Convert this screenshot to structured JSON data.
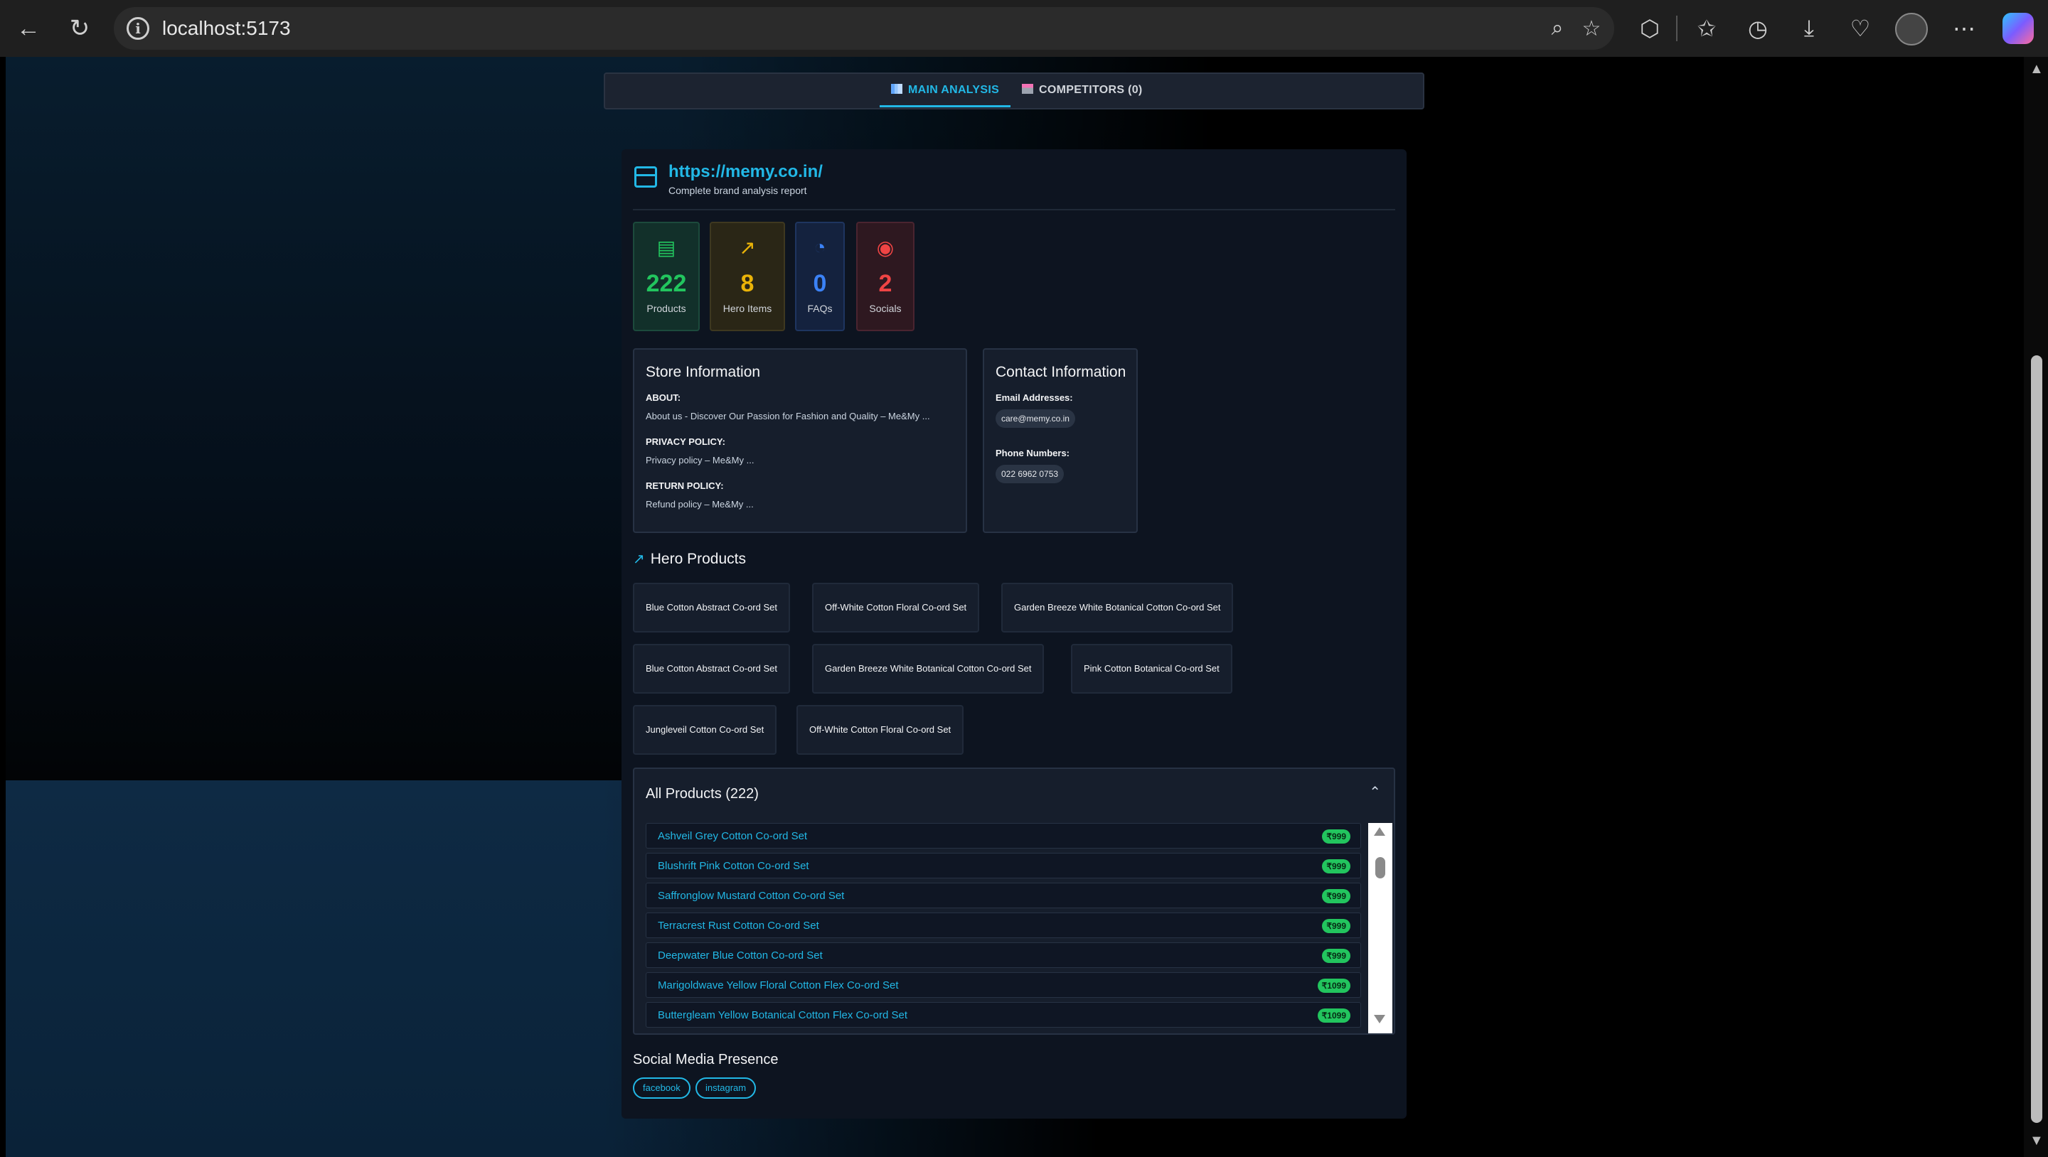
{
  "browser": {
    "url": "localhost:5173"
  },
  "tabs": [
    {
      "label": "MAIN ANALYSIS"
    },
    {
      "label": "COMPETITORS (0)"
    }
  ],
  "brand": {
    "url": "https://memy.co.in/",
    "subtitle": "Complete brand analysis report"
  },
  "stats": [
    {
      "value": "222",
      "label": "Products",
      "color": "#22c55e",
      "icon": "bar-chart-icon"
    },
    {
      "value": "8",
      "label": "Hero Items",
      "color": "#eab308",
      "icon": "trending-up-icon"
    },
    {
      "value": "0",
      "label": "FAQs",
      "color": "#3b82f6",
      "icon": "speedometer-icon"
    },
    {
      "value": "2",
      "label": "Socials",
      "color": "#ef4444",
      "icon": "eye-icon"
    }
  ],
  "store_info": {
    "title": "Store Information",
    "about_label": "ABOUT:",
    "about_value": "About us - Discover Our Passion for Fashion and Quality – Me&My ...",
    "privacy_label": "PRIVACY POLICY:",
    "privacy_value": "Privacy policy – Me&My ...",
    "return_label": "RETURN POLICY:",
    "return_value": "Refund policy – Me&My ..."
  },
  "contact_info": {
    "title": "Contact Information",
    "email_label": "Email Addresses:",
    "email": "care@memy.co.in",
    "phone_label": "Phone Numbers:",
    "phone": "022 6962 0753"
  },
  "hero_products": {
    "title": "Hero Products",
    "items": [
      "Blue Cotton Abstract Co-ord Set",
      "Off-White Cotton Floral Co-ord Set",
      "Garden Breeze White Botanical Cotton Co-ord Set",
      "Blue Cotton Abstract Co-ord Set",
      "Garden Breeze White Botanical Cotton Co-ord Set",
      "Pink Cotton Botanical Co-ord Set",
      "Jungleveil Cotton Co-ord Set",
      "Off-White Cotton Floral Co-ord Set"
    ]
  },
  "all_products": {
    "title": "All Products (222)",
    "items": [
      {
        "name": "Ashveil Grey Cotton Co-ord Set",
        "price": "₹999"
      },
      {
        "name": "Blushrift Pink Cotton Co-ord Set",
        "price": "₹999"
      },
      {
        "name": "Saffronglow Mustard Cotton Co-ord Set",
        "price": "₹999"
      },
      {
        "name": "Terracrest Rust Cotton Co-ord Set",
        "price": "₹999"
      },
      {
        "name": "Deepwater Blue Cotton Co-ord Set",
        "price": "₹999"
      },
      {
        "name": "Marigoldwave Yellow Floral Cotton Flex Co-ord Set",
        "price": "₹1099"
      },
      {
        "name": "Buttergleam Yellow Botanical Cotton Flex Co-ord Set",
        "price": "₹1099"
      }
    ]
  },
  "social": {
    "title": "Social Media Presence",
    "tags": [
      "facebook",
      "instagram"
    ]
  },
  "colors": {
    "accent": "#22b8e6",
    "price_badge": "#22c55e"
  }
}
